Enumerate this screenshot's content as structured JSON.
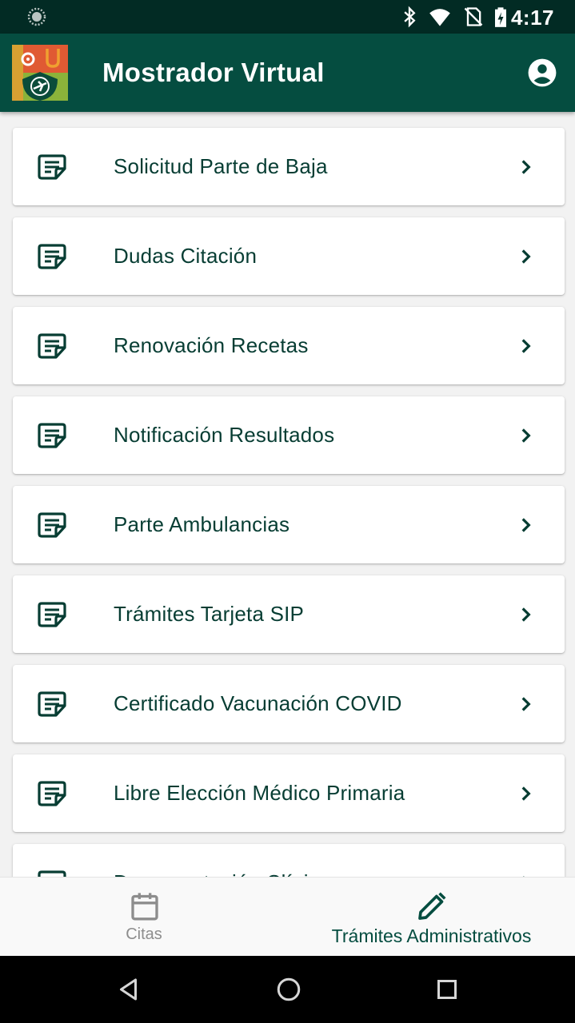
{
  "status_bar": {
    "time": "4:17",
    "icons": [
      "loading-spinner-icon",
      "bluetooth-icon",
      "wifi-icon",
      "no-sim-icon",
      "battery-charging-icon"
    ]
  },
  "app_bar": {
    "title": "Mostrador Virtual",
    "logo": "health-center-logo",
    "account_icon": "account-circle-icon"
  },
  "menu_items": [
    {
      "label": "Solicitud Parte de Baja",
      "icon": "document-icon"
    },
    {
      "label": "Dudas Citación",
      "icon": "document-icon"
    },
    {
      "label": "Renovación Recetas",
      "icon": "document-icon"
    },
    {
      "label": "Notificación Resultados",
      "icon": "document-icon"
    },
    {
      "label": "Parte Ambulancias",
      "icon": "document-icon"
    },
    {
      "label": "Trámites Tarjeta SIP",
      "icon": "document-icon"
    },
    {
      "label": "Certificado Vacunación COVID",
      "icon": "document-icon"
    },
    {
      "label": "Libre Elección Médico Primaria",
      "icon": "document-icon"
    },
    {
      "label": "Documentación Clínica",
      "icon": "document-icon"
    }
  ],
  "bottom_nav": {
    "items": [
      {
        "label": "Citas",
        "icon": "calendar-icon",
        "selected": false
      },
      {
        "label": "Trámites Administrativos",
        "icon": "pencil-icon",
        "selected": true
      }
    ]
  },
  "colors": {
    "status_bar": "#022b24",
    "app_bar": "#054d40",
    "item_text": "#073d33",
    "background": "#f2f2f2",
    "nav_inactive": "#8d8d8d"
  },
  "system_nav": {
    "buttons": [
      "back-triangle-icon",
      "home-circle-icon",
      "recents-square-icon"
    ]
  }
}
